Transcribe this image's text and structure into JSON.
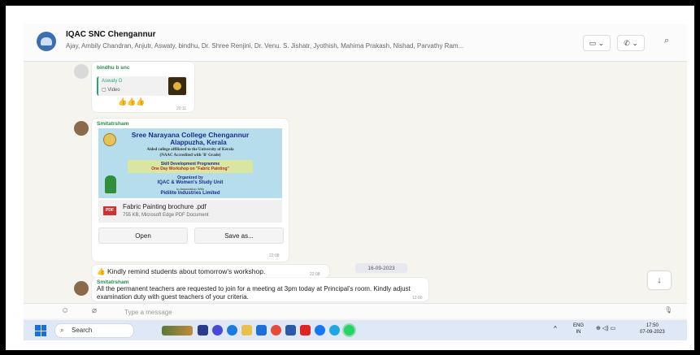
{
  "header": {
    "title": "IQAC SNC Chengannur",
    "members": "Ajay, Ambily Chandran, Anjutr, Aswaty, bindhu, Dr. Shree Renjini, Dr. Venu. S. Jishatr, Jyothish, Mahima Prakash, Nishad, Parvathy Ram...",
    "video_call_label": "▭ ⌄",
    "voice_call_label": "✆ ⌄",
    "search_icon": "⌕"
  },
  "messages": {
    "msg1": {
      "sender": "bindhu b snc",
      "quoted_name": "Aswaty D",
      "quoted_type": "Video",
      "reactions": "👍👍👍",
      "time": "20:11"
    },
    "msg2": {
      "sender": "Smitatrsham",
      "poster": {
        "college": "Sree Narayana College Chengannur",
        "place": "Alappuzha, Kerala",
        "affiliation": "Aided college affiliated to the University of Kerala",
        "accreditation": "(NAAC Accredited with 'B' Grade)",
        "programme": "Skill Development Programme",
        "workshop": "One Day Workshop on \"Fabric Painting\"",
        "organized_by": "Organized by",
        "organizer": "IQAC & Women's Study Unit",
        "association": "In Association With",
        "partner": "Pidilite Industries Limited"
      },
      "file_name": "Fabric Painting brochure .pdf",
      "file_meta": "755 KB, Microsoft Edge PDF Document",
      "open_label": "Open",
      "save_label": "Save as...",
      "pdf_badge": "PDF",
      "time": "22:08"
    },
    "msg3": {
      "text": "👍 Kindly remind students about tomorrow's workshop.",
      "time": "22:08"
    },
    "date_separator": "16-09-2023",
    "msg4": {
      "sender": "Smitatrsham",
      "text": "All the permanent teachers are requested to join for a meeting at 3pm today at Principal's room. Kindly adjust examination duty with guest teachers of your criteria.",
      "time": "12:00"
    }
  },
  "composer": {
    "placeholder": "Type a message",
    "emoji_icon": "☺",
    "attach_icon": "⌀",
    "mic_icon": "🎙"
  },
  "scroll_down_icon": "↓",
  "taskbar": {
    "search_label": "Search",
    "tray_lang": "ENG",
    "tray_region": "IN",
    "tray_icons": "⊕ ◁) ▭",
    "time": "17:50",
    "date": "07-09-2023",
    "chevron": "^"
  },
  "colors": {
    "chat_bg": "#f6f4ef",
    "sender_green": "#2a8a4d",
    "taskbar": "#dfe8f7",
    "windows_blue": "#1c6fd6"
  }
}
